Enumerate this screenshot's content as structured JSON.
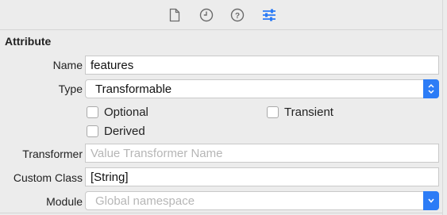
{
  "toolbar": {
    "icons": [
      "file-icon",
      "clock-icon",
      "help-icon",
      "sliders-icon"
    ],
    "active_color": "#2c7cf6"
  },
  "section": {
    "title": "Attribute"
  },
  "form": {
    "name_label": "Name",
    "name_value": "features",
    "type_label": "Type",
    "type_value": "Transformable",
    "optional_label": "Optional",
    "transient_label": "Transient",
    "derived_label": "Derived",
    "optional_checked": false,
    "transient_checked": false,
    "derived_checked": false,
    "transformer_label": "Transformer",
    "transformer_placeholder": "Value Transformer Name",
    "custom_class_label": "Custom Class",
    "custom_class_value": "[String]",
    "module_label": "Module",
    "module_placeholder": "Global namespace"
  }
}
